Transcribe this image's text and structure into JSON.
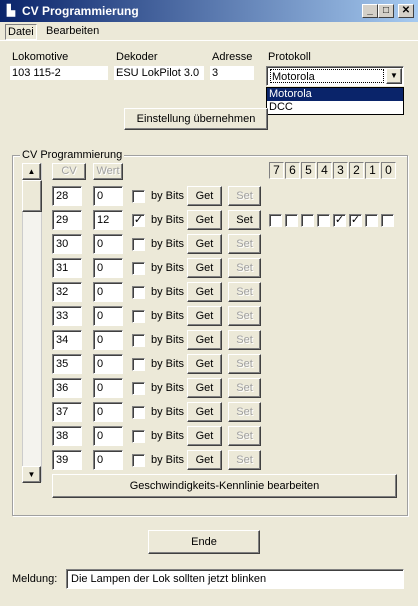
{
  "window": {
    "title": "CV Programmierung",
    "min_icon": "_",
    "max_icon": "□",
    "close_icon": "✕"
  },
  "menu": {
    "items": [
      "Datei",
      "Bearbeiten"
    ]
  },
  "header": {
    "lokomotive_label": "Lokomotive",
    "lokomotive_value": "103 115-2",
    "dekoder_label": "Dekoder",
    "dekoder_value": "ESU LokPilot 3.0",
    "adresse_label": "Adresse",
    "adresse_value": "3",
    "protokoll_label": "Protokoll",
    "protokoll_value": "Motorola",
    "protokoll_options": [
      "Motorola",
      "DCC"
    ],
    "apply_button": "Einstellung übernehmen"
  },
  "cv_group": {
    "title": "CV Programmierung",
    "col_cv": "CV",
    "col_wert": "Wert",
    "bits_label": "by Bits",
    "get_label": "Get",
    "set_label": "Set",
    "bit_headers": [
      "7",
      "6",
      "5",
      "4",
      "3",
      "2",
      "1",
      "0"
    ],
    "rows": [
      {
        "cv": "28",
        "wert": "0",
        "by_bits": false,
        "set_enabled": false
      },
      {
        "cv": "29",
        "wert": "12",
        "by_bits": true,
        "set_enabled": true,
        "bits": [
          false,
          false,
          false,
          false,
          true,
          true,
          false,
          false
        ]
      },
      {
        "cv": "30",
        "wert": "0",
        "by_bits": false,
        "set_enabled": false
      },
      {
        "cv": "31",
        "wert": "0",
        "by_bits": false,
        "set_enabled": false
      },
      {
        "cv": "32",
        "wert": "0",
        "by_bits": false,
        "set_enabled": false
      },
      {
        "cv": "33",
        "wert": "0",
        "by_bits": false,
        "set_enabled": false
      },
      {
        "cv": "34",
        "wert": "0",
        "by_bits": false,
        "set_enabled": false
      },
      {
        "cv": "35",
        "wert": "0",
        "by_bits": false,
        "set_enabled": false
      },
      {
        "cv": "36",
        "wert": "0",
        "by_bits": false,
        "set_enabled": false
      },
      {
        "cv": "37",
        "wert": "0",
        "by_bits": false,
        "set_enabled": false
      },
      {
        "cv": "38",
        "wert": "0",
        "by_bits": false,
        "set_enabled": false
      },
      {
        "cv": "39",
        "wert": "0",
        "by_bits": false,
        "set_enabled": false
      }
    ],
    "speed_curve_button": "Geschwindigkeits-Kennlinie bearbeiten"
  },
  "footer": {
    "end_button": "Ende",
    "meldung_label": "Meldung:",
    "meldung_value": "Die Lampen der Lok sollten jetzt blinken"
  }
}
